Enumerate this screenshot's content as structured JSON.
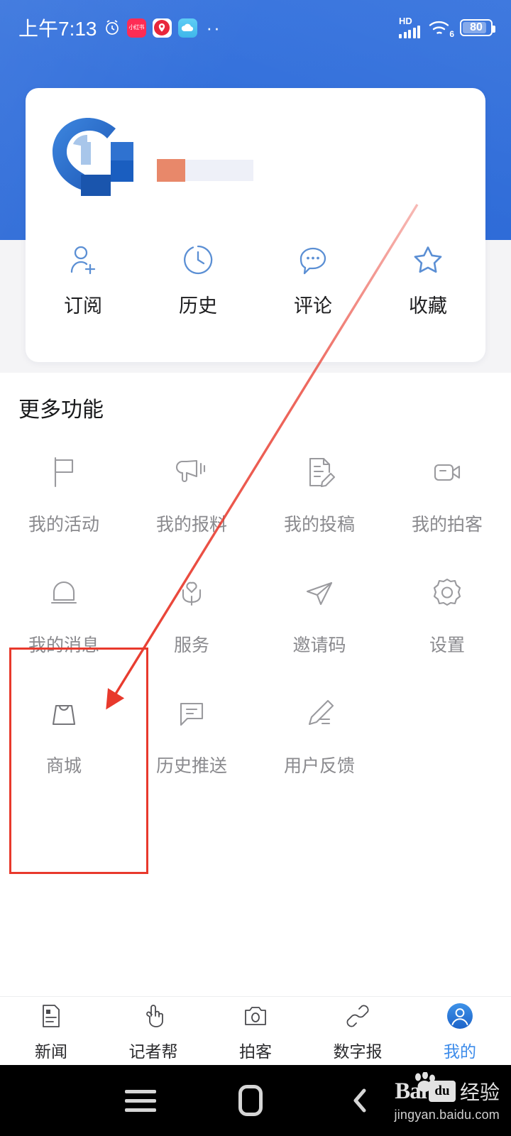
{
  "status_bar": {
    "time": "上午7:13",
    "alarm_icon": "alarm-clock-icon",
    "app_icons": [
      {
        "name": "xiaohongshu-icon",
        "label": "小红书"
      },
      {
        "name": "location-app-icon",
        "label": ""
      },
      {
        "name": "cloud-app-icon",
        "label": ""
      }
    ],
    "overflow_dots": "··",
    "hd_label": "HD",
    "signal_bars": 5,
    "wifi_label": "6",
    "battery_level": "80"
  },
  "profile": {
    "avatar_icon": "app-logo-avatar",
    "username_redacted": true,
    "quick_actions": [
      {
        "icon": "user-plus-icon",
        "label": "订阅"
      },
      {
        "icon": "clock-icon",
        "label": "历史"
      },
      {
        "icon": "comment-bubble-icon",
        "label": "评论"
      },
      {
        "icon": "star-icon",
        "label": "收藏"
      }
    ]
  },
  "more": {
    "title": "更多功能",
    "items": [
      {
        "icon": "flag-icon",
        "label": "我的活动"
      },
      {
        "icon": "megaphone-icon",
        "label": "我的报料"
      },
      {
        "icon": "document-edit-icon",
        "label": "我的投稿"
      },
      {
        "icon": "video-camera-icon",
        "label": "我的拍客"
      },
      {
        "icon": "bell-icon",
        "label": "我的消息"
      },
      {
        "icon": "heart-hands-icon",
        "label": "服务"
      },
      {
        "icon": "paper-plane-icon",
        "label": "邀请码"
      },
      {
        "icon": "gear-icon",
        "label": "设置"
      },
      {
        "icon": "shopping-bag-icon",
        "label": "商城"
      },
      {
        "icon": "message-square-icon",
        "label": "历史推送"
      },
      {
        "icon": "pencil-lines-icon",
        "label": "用户反馈"
      }
    ]
  },
  "tabbar": {
    "tabs": [
      {
        "icon": "news-document-icon",
        "label": "新闻",
        "active": false
      },
      {
        "icon": "hand-pointer-icon",
        "label": "记者帮",
        "active": false
      },
      {
        "icon": "camera-icon",
        "label": "拍客",
        "active": false
      },
      {
        "icon": "link-chain-icon",
        "label": "数字报",
        "active": false
      },
      {
        "icon": "person-circle-icon",
        "label": "我的",
        "active": true
      }
    ]
  },
  "navbar": {
    "menu_icon": "hamburger-menu-icon",
    "home_icon": "home-square-icon",
    "back_icon": "back-chevron-icon"
  },
  "watermark": {
    "brand": "Bai",
    "du": "du",
    "suffix": "经验",
    "url": "jingyan.baidu.com"
  },
  "annotations": {
    "highlight_box_target": "商城",
    "arrow_color": "#e8392c",
    "box_color": "#e8392c"
  },
  "colors": {
    "header_blue": "#2f6fdc",
    "accent_blue": "#3c8bea",
    "quick_icon_blue": "#5b8fd4",
    "grid_icon_gray": "#8a8a8e",
    "annotation_red": "#e8392c"
  }
}
